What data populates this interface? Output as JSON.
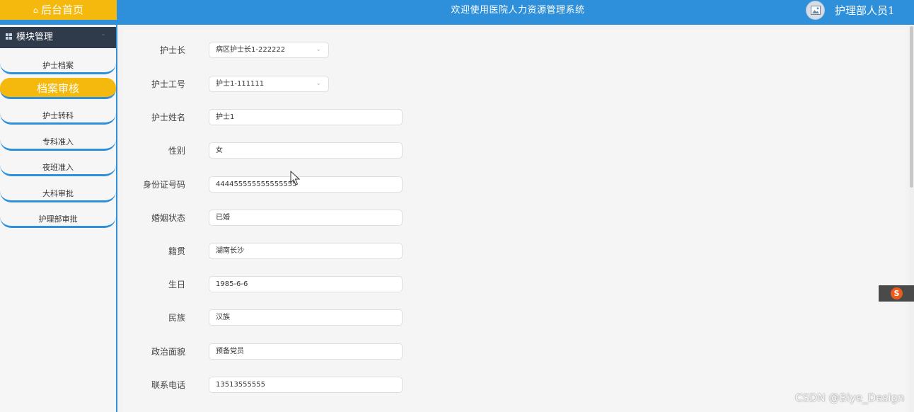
{
  "topbar": {
    "home_label": "后台首页",
    "home_icon": "home-icon",
    "title": "欢迎使用医院人力资源管理系统",
    "user": "护理部人员1",
    "avatar_icon": "image-icon",
    "colors": {
      "bar": "#2e8fdb",
      "accent": "#f5b90e"
    }
  },
  "sidebar": {
    "header": "模块管理",
    "items": [
      {
        "label": "护士档案",
        "active": false
      },
      {
        "label": "档案审核",
        "active": true
      },
      {
        "label": "护士转科",
        "active": false
      },
      {
        "label": "专科准入",
        "active": false
      },
      {
        "label": "夜班准入",
        "active": false
      },
      {
        "label": "大科审批",
        "active": false
      },
      {
        "label": "护理部审批",
        "active": false
      }
    ]
  },
  "form": {
    "fields": [
      {
        "label": "护士长",
        "value": "病区护士长1-222222",
        "type": "select"
      },
      {
        "label": "护士工号",
        "value": "护士1-111111",
        "type": "select"
      },
      {
        "label": "护士姓名",
        "value": "护士1",
        "type": "input"
      },
      {
        "label": "性别",
        "value": "女",
        "type": "input"
      },
      {
        "label": "身份证号码",
        "value": "444455555555555555",
        "type": "input"
      },
      {
        "label": "婚姻状态",
        "value": "已婚",
        "type": "input"
      },
      {
        "label": "籍贯",
        "value": "湖南长沙",
        "type": "input"
      },
      {
        "label": "生日",
        "value": "1985-6-6",
        "type": "input"
      },
      {
        "label": "民族",
        "value": "汉族",
        "type": "input"
      },
      {
        "label": "政治面貌",
        "value": "预备党员",
        "type": "input"
      },
      {
        "label": "联系电话",
        "value": "13513555555",
        "type": "input"
      }
    ]
  },
  "watermark": "CSDN @Biye_Design"
}
